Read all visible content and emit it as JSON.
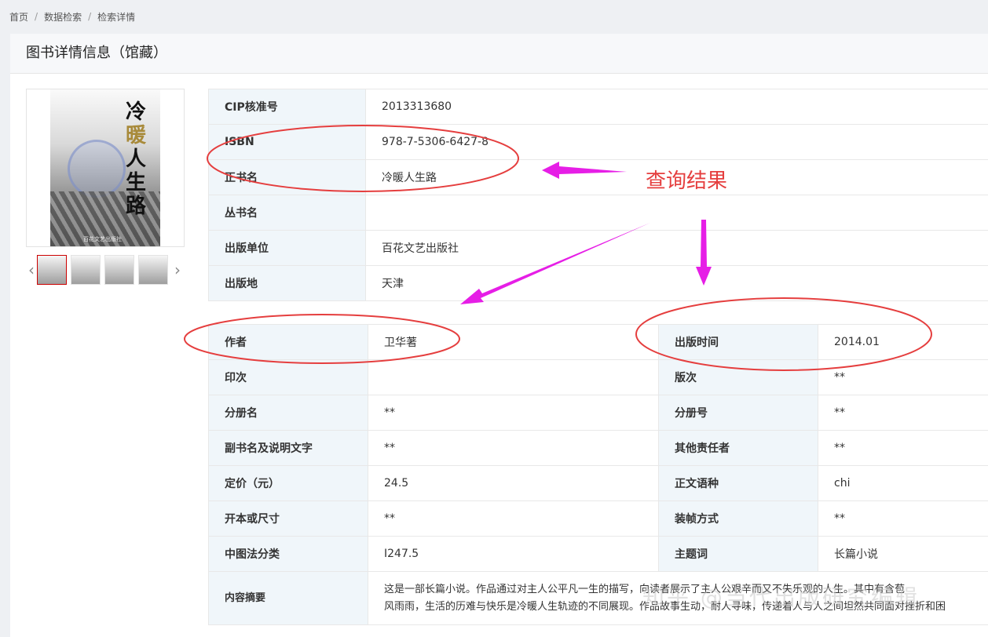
{
  "breadcrumb": [
    "首页",
    "数据检索",
    "检索详情"
  ],
  "panel_title": "图书详情信息（馆藏）",
  "cover": {
    "title_chars": [
      "冷",
      "暖",
      "人",
      "生",
      "路"
    ],
    "publisher_small": "百花文艺出版社"
  },
  "thumbnails": {
    "count": 4,
    "prev_icon": "chevron-left-icon",
    "next_icon": "chevron-right-icon"
  },
  "top_table": [
    {
      "label": "CIP核准号",
      "value": "2013313680"
    },
    {
      "label": "ISBN",
      "value": "978-7-5306-6427-8"
    },
    {
      "label": "正书名",
      "value": "冷暖人生路"
    },
    {
      "label": "丛书名",
      "value": ""
    },
    {
      "label": "出版单位",
      "value": "百花文艺出版社"
    },
    {
      "label": "出版地",
      "value": "天津"
    }
  ],
  "bottom_table": [
    {
      "l1": "作者",
      "v1": "卫华著",
      "l2": "出版时间",
      "v2": "2014.01"
    },
    {
      "l1": "印次",
      "v1": "",
      "l2": "版次",
      "v2": "**"
    },
    {
      "l1": "分册名",
      "v1": "**",
      "l2": "分册号",
      "v2": "**"
    },
    {
      "l1": "副书名及说明文字",
      "v1": "**",
      "l2": "其他责任者",
      "v2": "**"
    },
    {
      "l1": "定价（元）",
      "v1": "24.5",
      "l2": "正文语种",
      "v2": "chi"
    },
    {
      "l1": "开本或尺寸",
      "v1": "**",
      "l2": "装帧方式",
      "v2": "**"
    },
    {
      "l1": "中图法分类",
      "v1": "I247.5",
      "l2": "主题词",
      "v2": "长篇小说"
    }
  ],
  "summary": {
    "label": "内容摘要",
    "line1": "这是一部长篇小说。作品通过对主人公平凡一生的描写，向读者展示了主人公艰辛而又不失乐观的人生。其中有含苞",
    "line2": "风雨雨，生活的历难与快乐是冷暖人生轨迹的不同展现。作品故事生动，耐人寻味，传递着人与人之间坦然共同面对挫折和困"
  },
  "annotation": {
    "callout": "查询结果",
    "color": "#e53e3e",
    "arrow_color": "#e61ee6"
  },
  "watermark": "知乎 @当代出版研究编辑"
}
